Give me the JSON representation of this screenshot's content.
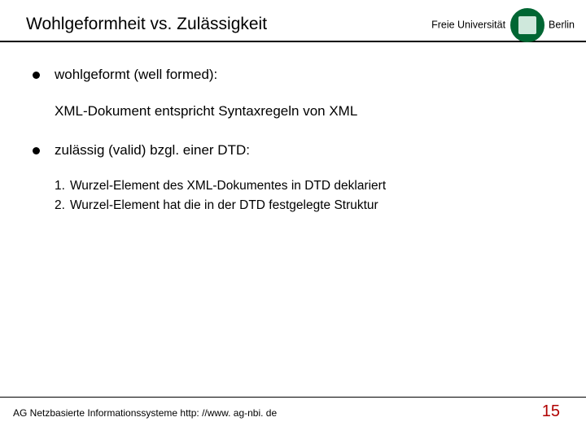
{
  "header": {
    "title": "Wohlgeformheit vs. Zulässigkeit",
    "logo": {
      "line1": "Freie Universität",
      "line2": "Berlin"
    }
  },
  "bullets": [
    {
      "heading": "wohlgeformt (well formed):",
      "description": "XML-Dokument entspricht Syntaxregeln von XML"
    },
    {
      "heading": "zulässig (valid) bzgl. einer DTD:",
      "sublist": [
        {
          "num": "1.",
          "text": "Wurzel-Element des XML-Dokumentes in DTD deklariert"
        },
        {
          "num": "2.",
          "text": "Wurzel-Element hat die in der DTD festgelegte Struktur"
        }
      ]
    }
  ],
  "footer": {
    "text": "AG Netzbasierte Informationssysteme http: //www. ag-nbi. de",
    "page": "15"
  }
}
